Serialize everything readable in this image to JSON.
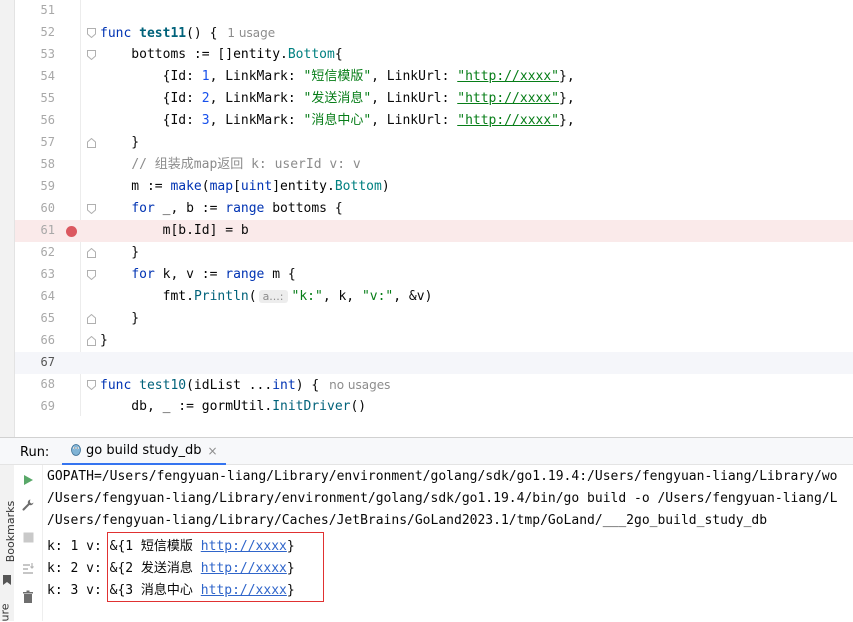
{
  "editor": {
    "lines": [
      {
        "n": "51"
      },
      {
        "n": "52",
        "hint": "1 usage"
      },
      {
        "n": "53"
      },
      {
        "n": "54",
        "linkmark": "\"短信模版\"",
        "url": "\"http://xxxx\""
      },
      {
        "n": "55",
        "linkmark": "\"发送消息\"",
        "url": "\"http://xxxx\""
      },
      {
        "n": "56",
        "linkmark": "\"消息中心\"",
        "url": "\"http://xxxx\""
      },
      {
        "n": "57"
      },
      {
        "n": "58",
        "comment": "// 组装成map返回 k: userId v: v"
      },
      {
        "n": "59"
      },
      {
        "n": "60"
      },
      {
        "n": "61"
      },
      {
        "n": "62"
      },
      {
        "n": "63"
      },
      {
        "n": "64",
        "inlay": "a...:"
      },
      {
        "n": "65"
      },
      {
        "n": "66"
      },
      {
        "n": "67"
      },
      {
        "n": "68",
        "hint": "no usages"
      },
      {
        "n": "69"
      }
    ]
  },
  "run": {
    "label": "Run:",
    "tab_label": "go build study_db",
    "tab_close": "×",
    "side_label_bookmarks": "Bookmarks",
    "side_label_structure": "ure",
    "console": [
      "GOPATH=/Users/fengyuan-liang/Library/environment/golang/sdk/go1.19.4:/Users/fengyuan-liang/Library/wo",
      "/Users/fengyuan-liang/Library/environment/golang/sdk/go1.19.4/bin/go build -o /Users/fengyuan-liang/L",
      "/Users/fengyuan-liang/Library/Caches/JetBrains/GoLand2023.1/tmp/GoLand/___2go_build_study_db"
    ],
    "results": [
      {
        "prefix": "k: 1 v: ",
        "body": "&{1 短信模版 ",
        "link": "http://xxxx",
        "suffix": "}"
      },
      {
        "prefix": "k: 2 v: ",
        "body": "&{2 发送消息 ",
        "link": "http://xxxx",
        "suffix": "}"
      },
      {
        "prefix": "k: 3 v: ",
        "body": "&{3 消息中心 ",
        "link": "http://xxxx",
        "suffix": "}"
      }
    ]
  },
  "icons": [
    "run-icon",
    "wrench-icon",
    "stop-icon",
    "sort-icon",
    "trash-icon",
    "gopher-icon",
    "bookmark-icon",
    "fold-icon",
    "breakpoint-icon"
  ],
  "colors": {
    "keyword": "#0033b3",
    "string": "#067d17",
    "number": "#1750eb",
    "breakpoint": "#db5860",
    "highlight_box": "#e03131",
    "tab_underline": "#3574f0"
  }
}
